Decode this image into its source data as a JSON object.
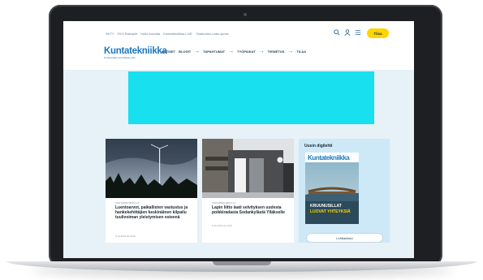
{
  "header": {
    "top_links": [
      "SKTY",
      "FKG Rakolyht",
      "Kello-kuvioita",
      "Kuntatekniikka LIVE",
      "Yksikuvien-uutis-sposs"
    ],
    "subscribe_label": "Tilaa",
    "icons": [
      "search-icon",
      "user-icon",
      "menu-icon"
    ]
  },
  "brand": {
    "logo_text": "Kuntatekniikka",
    "tagline": "Kuntatekniikan ammattilaisten lehti",
    "color": "#1a78bf"
  },
  "nav": {
    "items": [
      "UUTISET",
      "BLOGIT",
      "TAPAHTUMAT",
      "TYÖPAIKAT",
      "TIEWETUS",
      "TILAA"
    ]
  },
  "ad": {
    "color": "#18e0ee"
  },
  "articles": [
    {
      "category": "KUNTATEKNIIKKA.FI",
      "title": "Luentoarvot, paikallisten vastustus ja hankekehittäjien keskinäinen kilpailu tuulivoiman yleistymisen esteenä",
      "date": "5.10.2022 klo 8:00"
    },
    {
      "category": "KUNTATEKNIIKKA.FI",
      "title": "Lapin liitto laati selvityksen uudesta poikkiradasta Sodankylästä Ylläkselle",
      "date": "5.10.2022 klo 9:00"
    }
  ],
  "digilehti": {
    "title": "Uusin digilehti",
    "magazine_name": "Kuntatekniikka",
    "cover_line_1": "KRUUNUSILLAT",
    "cover_line_2": "LUOVAT YHTEYKSIÄ",
    "archive_button": "Lehtiarkisto"
  }
}
